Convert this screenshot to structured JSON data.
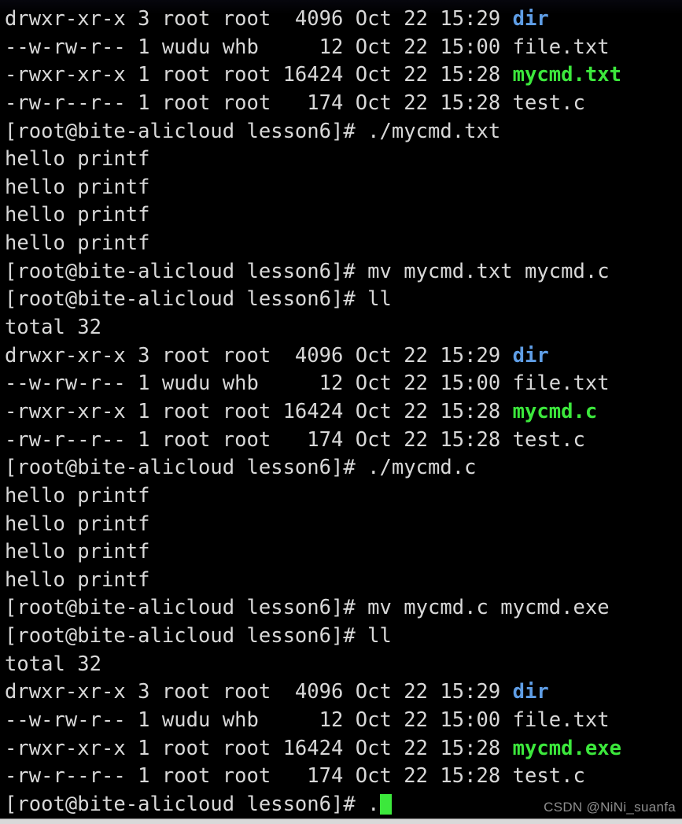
{
  "terminal": {
    "background_color": "#000000",
    "foreground_color": "#d8d8d8",
    "dir_color": "#5f9ee6",
    "exec_color": "#3ce83c",
    "cursor_color": "#3ce83c",
    "hostname": "bite-alicloud",
    "user": "root",
    "cwd": "lesson6",
    "prompt": "[root@bite-alicloud lesson6]# ",
    "lines": [
      {
        "id": "l01",
        "type": "listing",
        "segments": [
          {
            "text": "drwxr-xr-x 3 root root  4096 Oct 22 15:29 ",
            "color": "default"
          },
          {
            "text": "dir",
            "color": "dir"
          }
        ]
      },
      {
        "id": "l02",
        "type": "listing",
        "segments": [
          {
            "text": "--w-rw-r-- 1 wudu whb     12 Oct 22 15:00 file.txt",
            "color": "default"
          }
        ]
      },
      {
        "id": "l03",
        "type": "listing",
        "segments": [
          {
            "text": "-rwxr-xr-x 1 root root 16424 Oct 22 15:28 ",
            "color": "default"
          },
          {
            "text": "mycmd.txt",
            "color": "exec"
          }
        ]
      },
      {
        "id": "l04",
        "type": "listing",
        "segments": [
          {
            "text": "-rw-r--r-- 1 root root   174 Oct 22 15:28 test.c",
            "color": "default"
          }
        ]
      },
      {
        "id": "l05",
        "type": "command",
        "segments": [
          {
            "text": "[root@bite-alicloud lesson6]# ./mycmd.txt",
            "color": "default"
          }
        ]
      },
      {
        "id": "l06",
        "type": "output",
        "segments": [
          {
            "text": "hello printf",
            "color": "default"
          }
        ]
      },
      {
        "id": "l07",
        "type": "output",
        "segments": [
          {
            "text": "hello printf",
            "color": "default"
          }
        ]
      },
      {
        "id": "l08",
        "type": "output",
        "segments": [
          {
            "text": "hello printf",
            "color": "default"
          }
        ]
      },
      {
        "id": "l09",
        "type": "output",
        "segments": [
          {
            "text": "hello printf",
            "color": "default"
          }
        ]
      },
      {
        "id": "l10",
        "type": "command",
        "segments": [
          {
            "text": "[root@bite-alicloud lesson6]# mv mycmd.txt mycmd.c",
            "color": "default"
          }
        ]
      },
      {
        "id": "l11",
        "type": "command",
        "segments": [
          {
            "text": "[root@bite-alicloud lesson6]# ll",
            "color": "default"
          }
        ]
      },
      {
        "id": "l12",
        "type": "output",
        "segments": [
          {
            "text": "total 32",
            "color": "default"
          }
        ]
      },
      {
        "id": "l13",
        "type": "listing",
        "segments": [
          {
            "text": "drwxr-xr-x 3 root root  4096 Oct 22 15:29 ",
            "color": "default"
          },
          {
            "text": "dir",
            "color": "dir"
          }
        ]
      },
      {
        "id": "l14",
        "type": "listing",
        "segments": [
          {
            "text": "--w-rw-r-- 1 wudu whb     12 Oct 22 15:00 file.txt",
            "color": "default"
          }
        ]
      },
      {
        "id": "l15",
        "type": "listing",
        "segments": [
          {
            "text": "-rwxr-xr-x 1 root root 16424 Oct 22 15:28 ",
            "color": "default"
          },
          {
            "text": "mycmd.c",
            "color": "exec"
          }
        ]
      },
      {
        "id": "l16",
        "type": "listing",
        "segments": [
          {
            "text": "-rw-r--r-- 1 root root   174 Oct 22 15:28 test.c",
            "color": "default"
          }
        ]
      },
      {
        "id": "l17",
        "type": "command",
        "segments": [
          {
            "text": "[root@bite-alicloud lesson6]# ./mycmd.c",
            "color": "default"
          }
        ]
      },
      {
        "id": "l18",
        "type": "output",
        "segments": [
          {
            "text": "hello printf",
            "color": "default"
          }
        ]
      },
      {
        "id": "l19",
        "type": "output",
        "segments": [
          {
            "text": "hello printf",
            "color": "default"
          }
        ]
      },
      {
        "id": "l20",
        "type": "output",
        "segments": [
          {
            "text": "hello printf",
            "color": "default"
          }
        ]
      },
      {
        "id": "l21",
        "type": "output",
        "segments": [
          {
            "text": "hello printf",
            "color": "default"
          }
        ]
      },
      {
        "id": "l22",
        "type": "command",
        "segments": [
          {
            "text": "[root@bite-alicloud lesson6]# mv mycmd.c mycmd.exe",
            "color": "default"
          }
        ]
      },
      {
        "id": "l23",
        "type": "command",
        "segments": [
          {
            "text": "[root@bite-alicloud lesson6]# ll",
            "color": "default"
          }
        ]
      },
      {
        "id": "l24",
        "type": "output",
        "segments": [
          {
            "text": "total 32",
            "color": "default"
          }
        ]
      },
      {
        "id": "l25",
        "type": "listing",
        "segments": [
          {
            "text": "drwxr-xr-x 3 root root  4096 Oct 22 15:29 ",
            "color": "default"
          },
          {
            "text": "dir",
            "color": "dir"
          }
        ]
      },
      {
        "id": "l26",
        "type": "listing",
        "segments": [
          {
            "text": "--w-rw-r-- 1 wudu whb     12 Oct 22 15:00 file.txt",
            "color": "default"
          }
        ]
      },
      {
        "id": "l27",
        "type": "listing",
        "segments": [
          {
            "text": "-rwxr-xr-x 1 root root 16424 Oct 22 15:28 ",
            "color": "default"
          },
          {
            "text": "mycmd.exe",
            "color": "exec"
          }
        ]
      },
      {
        "id": "l28",
        "type": "listing",
        "segments": [
          {
            "text": "-rw-r--r-- 1 root root   174 Oct 22 15:28 test.c",
            "color": "default"
          }
        ]
      },
      {
        "id": "l29",
        "type": "prompt",
        "cursor": true,
        "segments": [
          {
            "text": "[root@bite-alicloud lesson6]# .",
            "color": "default"
          }
        ]
      }
    ]
  },
  "watermark": {
    "text": "CSDN @NiNi_suanfa"
  }
}
